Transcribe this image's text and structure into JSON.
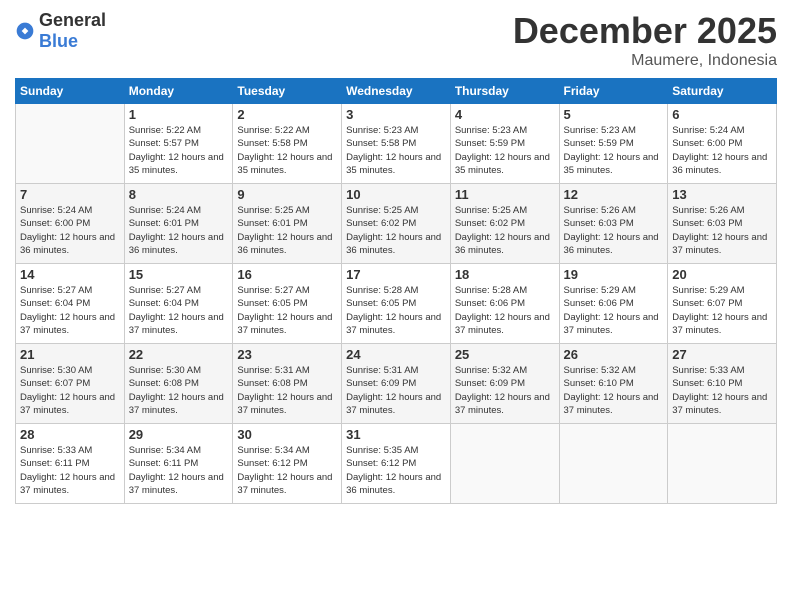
{
  "logo": {
    "general": "General",
    "blue": "Blue"
  },
  "title": "December 2025",
  "location": "Maumere, Indonesia",
  "days_of_week": [
    "Sunday",
    "Monday",
    "Tuesday",
    "Wednesday",
    "Thursday",
    "Friday",
    "Saturday"
  ],
  "weeks": [
    [
      {
        "day": "",
        "info": ""
      },
      {
        "day": "1",
        "info": "Sunrise: 5:22 AM\nSunset: 5:57 PM\nDaylight: 12 hours\nand 35 minutes."
      },
      {
        "day": "2",
        "info": "Sunrise: 5:22 AM\nSunset: 5:58 PM\nDaylight: 12 hours\nand 35 minutes."
      },
      {
        "day": "3",
        "info": "Sunrise: 5:23 AM\nSunset: 5:58 PM\nDaylight: 12 hours\nand 35 minutes."
      },
      {
        "day": "4",
        "info": "Sunrise: 5:23 AM\nSunset: 5:59 PM\nDaylight: 12 hours\nand 35 minutes."
      },
      {
        "day": "5",
        "info": "Sunrise: 5:23 AM\nSunset: 5:59 PM\nDaylight: 12 hours\nand 35 minutes."
      },
      {
        "day": "6",
        "info": "Sunrise: 5:24 AM\nSunset: 6:00 PM\nDaylight: 12 hours\nand 36 minutes."
      }
    ],
    [
      {
        "day": "7",
        "info": "Sunrise: 5:24 AM\nSunset: 6:00 PM\nDaylight: 12 hours\nand 36 minutes."
      },
      {
        "day": "8",
        "info": "Sunrise: 5:24 AM\nSunset: 6:01 PM\nDaylight: 12 hours\nand 36 minutes."
      },
      {
        "day": "9",
        "info": "Sunrise: 5:25 AM\nSunset: 6:01 PM\nDaylight: 12 hours\nand 36 minutes."
      },
      {
        "day": "10",
        "info": "Sunrise: 5:25 AM\nSunset: 6:02 PM\nDaylight: 12 hours\nand 36 minutes."
      },
      {
        "day": "11",
        "info": "Sunrise: 5:25 AM\nSunset: 6:02 PM\nDaylight: 12 hours\nand 36 minutes."
      },
      {
        "day": "12",
        "info": "Sunrise: 5:26 AM\nSunset: 6:03 PM\nDaylight: 12 hours\nand 36 minutes."
      },
      {
        "day": "13",
        "info": "Sunrise: 5:26 AM\nSunset: 6:03 PM\nDaylight: 12 hours\nand 37 minutes."
      }
    ],
    [
      {
        "day": "14",
        "info": "Sunrise: 5:27 AM\nSunset: 6:04 PM\nDaylight: 12 hours\nand 37 minutes."
      },
      {
        "day": "15",
        "info": "Sunrise: 5:27 AM\nSunset: 6:04 PM\nDaylight: 12 hours\nand 37 minutes."
      },
      {
        "day": "16",
        "info": "Sunrise: 5:27 AM\nSunset: 6:05 PM\nDaylight: 12 hours\nand 37 minutes."
      },
      {
        "day": "17",
        "info": "Sunrise: 5:28 AM\nSunset: 6:05 PM\nDaylight: 12 hours\nand 37 minutes."
      },
      {
        "day": "18",
        "info": "Sunrise: 5:28 AM\nSunset: 6:06 PM\nDaylight: 12 hours\nand 37 minutes."
      },
      {
        "day": "19",
        "info": "Sunrise: 5:29 AM\nSunset: 6:06 PM\nDaylight: 12 hours\nand 37 minutes."
      },
      {
        "day": "20",
        "info": "Sunrise: 5:29 AM\nSunset: 6:07 PM\nDaylight: 12 hours\nand 37 minutes."
      }
    ],
    [
      {
        "day": "21",
        "info": "Sunrise: 5:30 AM\nSunset: 6:07 PM\nDaylight: 12 hours\nand 37 minutes."
      },
      {
        "day": "22",
        "info": "Sunrise: 5:30 AM\nSunset: 6:08 PM\nDaylight: 12 hours\nand 37 minutes."
      },
      {
        "day": "23",
        "info": "Sunrise: 5:31 AM\nSunset: 6:08 PM\nDaylight: 12 hours\nand 37 minutes."
      },
      {
        "day": "24",
        "info": "Sunrise: 5:31 AM\nSunset: 6:09 PM\nDaylight: 12 hours\nand 37 minutes."
      },
      {
        "day": "25",
        "info": "Sunrise: 5:32 AM\nSunset: 6:09 PM\nDaylight: 12 hours\nand 37 minutes."
      },
      {
        "day": "26",
        "info": "Sunrise: 5:32 AM\nSunset: 6:10 PM\nDaylight: 12 hours\nand 37 minutes."
      },
      {
        "day": "27",
        "info": "Sunrise: 5:33 AM\nSunset: 6:10 PM\nDaylight: 12 hours\nand 37 minutes."
      }
    ],
    [
      {
        "day": "28",
        "info": "Sunrise: 5:33 AM\nSunset: 6:11 PM\nDaylight: 12 hours\nand 37 minutes."
      },
      {
        "day": "29",
        "info": "Sunrise: 5:34 AM\nSunset: 6:11 PM\nDaylight: 12 hours\nand 37 minutes."
      },
      {
        "day": "30",
        "info": "Sunrise: 5:34 AM\nSunset: 6:12 PM\nDaylight: 12 hours\nand 37 minutes."
      },
      {
        "day": "31",
        "info": "Sunrise: 5:35 AM\nSunset: 6:12 PM\nDaylight: 12 hours\nand 36 minutes."
      },
      {
        "day": "",
        "info": ""
      },
      {
        "day": "",
        "info": ""
      },
      {
        "day": "",
        "info": ""
      }
    ]
  ]
}
